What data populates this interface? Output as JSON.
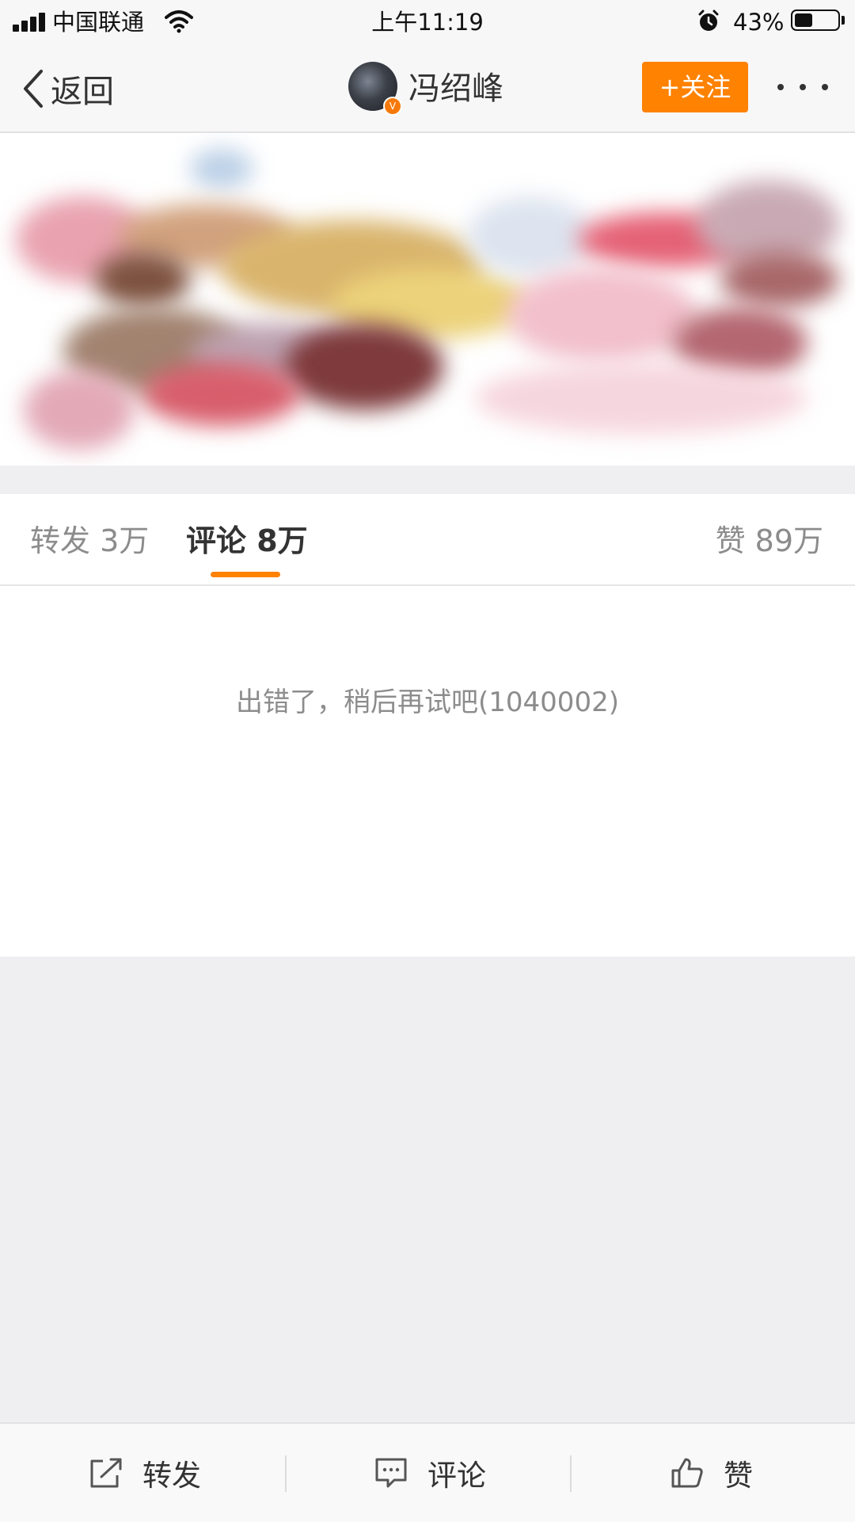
{
  "status_bar": {
    "carrier": "中国联通",
    "time": "上午11:19",
    "battery_text": "43%",
    "battery_level": 0.43,
    "icons": [
      "signal-icon",
      "wifi-icon",
      "alarm-icon",
      "battery-icon"
    ]
  },
  "nav": {
    "back_label": "返回",
    "user_name": "冯绍峰",
    "verified_badge": "V",
    "follow_label": "+关注",
    "accent_color": "#ff8200"
  },
  "stats_tabs": {
    "reposts": "转发 3万",
    "comments": "评论 8万",
    "likes": "赞 89万",
    "active_tab": "comments"
  },
  "comments": {
    "error_message": "出错了，稍后再试吧(1040002)"
  },
  "toolbar": {
    "repost_label": "转发",
    "comment_label": "评论",
    "like_label": "赞"
  }
}
